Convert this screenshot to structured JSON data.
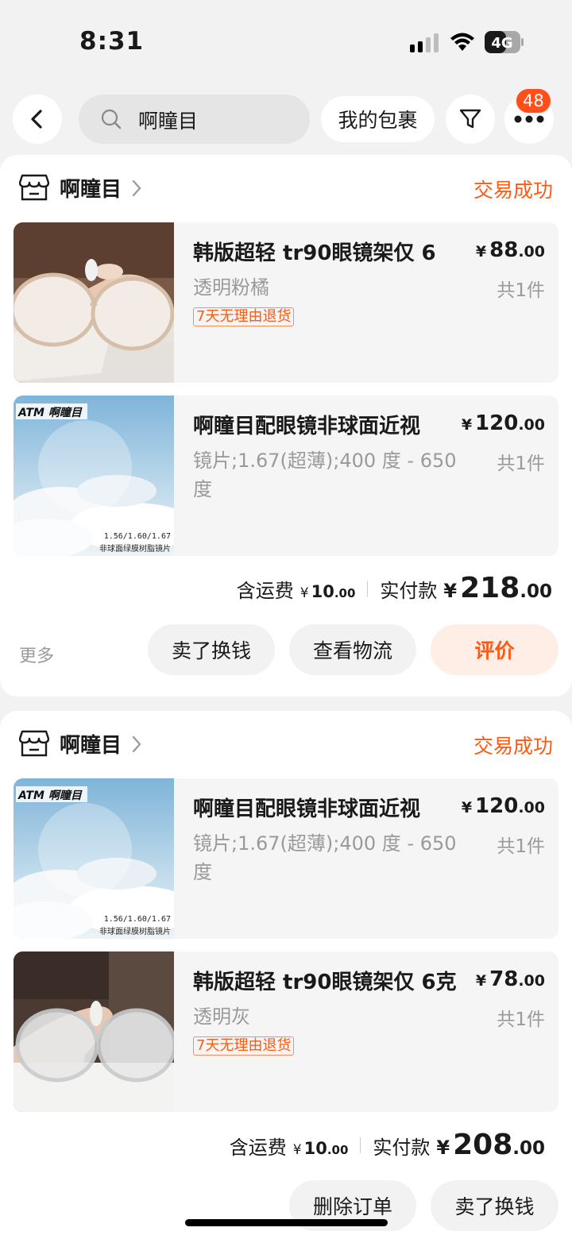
{
  "status_bar": {
    "time": "8:31",
    "network": "4G"
  },
  "search": {
    "query": "啊瞳目"
  },
  "header": {
    "parcel_button": "我的包裹",
    "badge_count": "48"
  },
  "orders": [
    {
      "shop_name": "啊瞳目",
      "status": "交易成功",
      "items": [
        {
          "title": "韩版超轻 tr90眼镜架仅 6",
          "spec": "透明粉橘",
          "tag": "7天无理由退货",
          "price_int": "88",
          "price_dec": ".00",
          "quantity": "共1件"
        },
        {
          "title": "啊瞳目配眼镜非球面近视",
          "spec": "镜片;1.67(超薄);400 度 - 650 度",
          "price_int": "120",
          "price_dec": ".00",
          "quantity": "共1件",
          "image_brand": "ATM 啊瞳目",
          "image_caption1": "1.56/1.60/1.67",
          "image_caption2": "非球面绿膜树脂镜片"
        }
      ],
      "shipping_label": "含运费",
      "shipping_int": "10",
      "shipping_dec": ".00",
      "paid_label": "实付款",
      "paid_int": "218",
      "paid_dec": ".00",
      "more_label": "更多",
      "buttons": [
        "卖了换钱",
        "查看物流",
        "评价"
      ]
    },
    {
      "shop_name": "啊瞳目",
      "status": "交易成功",
      "items": [
        {
          "title": "啊瞳目配眼镜非球面近视",
          "spec": "镜片;1.67(超薄);400 度 - 650 度",
          "price_int": "120",
          "price_dec": ".00",
          "quantity": "共1件",
          "image_brand": "ATM 啊瞳目",
          "image_caption1": "1.56/1.60/1.67",
          "image_caption2": "非球面绿膜树脂镜片"
        },
        {
          "title": "韩版超轻 tr90眼镜架仅 6克",
          "spec": "透明灰",
          "tag": "7天无理由退货",
          "price_int": "78",
          "price_dec": ".00",
          "quantity": "共1件"
        }
      ],
      "shipping_label": "含运费",
      "shipping_int": "10",
      "shipping_dec": ".00",
      "paid_label": "实付款",
      "paid_int": "208",
      "paid_dec": ".00",
      "buttons": [
        "删除订单",
        "卖了换钱"
      ]
    }
  ],
  "currency_symbol": "¥",
  "colors": {
    "accent": "#ff5a13",
    "badge": "#ff4f1a",
    "background": "#f2f2f2"
  },
  "icons": [
    "back-icon",
    "search-icon",
    "filter-icon",
    "more-dots-icon",
    "shop-icon",
    "chevron-right-icon",
    "signal-icon",
    "wifi-icon",
    "battery-icon"
  ]
}
